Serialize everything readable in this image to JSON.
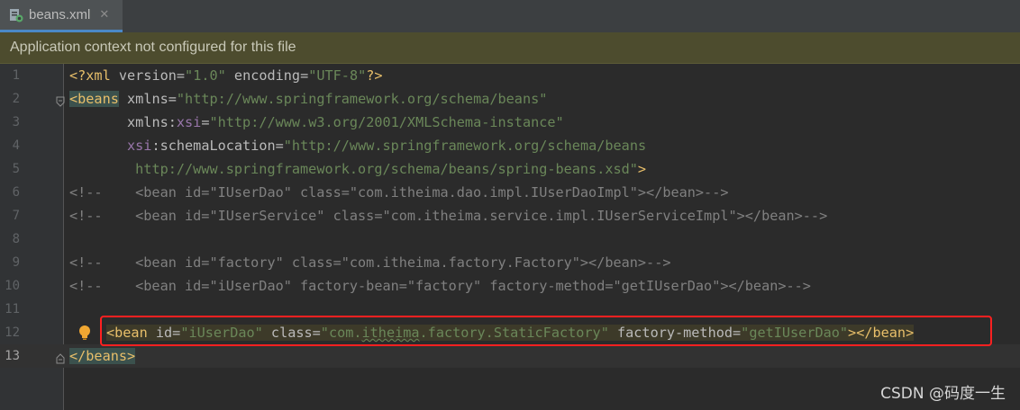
{
  "tab": {
    "filename": "beans.xml",
    "close": "✕",
    "icon": "xml-file-icon"
  },
  "banner": {
    "text": "Application context not configured for this file"
  },
  "lines": [
    {
      "n": "1"
    },
    {
      "n": "2"
    },
    {
      "n": "3"
    },
    {
      "n": "4"
    },
    {
      "n": "5"
    },
    {
      "n": "6"
    },
    {
      "n": "7"
    },
    {
      "n": "8"
    },
    {
      "n": "9"
    },
    {
      "n": "10"
    },
    {
      "n": "11"
    },
    {
      "n": "12"
    },
    {
      "n": "13"
    }
  ],
  "code": {
    "l1": {
      "open": "<?xml ",
      "a1": "version",
      "eq1": "=",
      "v1": "\"1.0\"",
      "sp": " ",
      "a2": "encoding",
      "eq2": "=",
      "v2": "\"UTF-8\"",
      "close": "?>"
    },
    "l2": {
      "tag": "<beans",
      "a1": "xmlns",
      "eq1": "=",
      "v1": "\"http://www.springframework.org/schema/beans\""
    },
    "l3": {
      "a1": "xmlns",
      "colon": ":",
      "ns": "xsi",
      "eq1": "=",
      "v1": "\"http://www.w3.org/2001/XMLSchema-instance\""
    },
    "l4": {
      "ns": "xsi",
      "colon": ":",
      "a1": "schemaLocation",
      "eq1": "=",
      "v1": "\"http://www.springframework.org/schema/beans"
    },
    "l5": {
      "v1": "http://www.springframework.org/schema/beans/spring-beans.xsd\"",
      "close": ">"
    },
    "l6": "<!--    <bean id=\"IUserDao\" class=\"com.itheima.dao.impl.IUserDaoImpl\"></bean>-->",
    "l7": "<!--    <bean id=\"IUserService\" class=\"com.itheima.service.impl.IUserServiceImpl\"></bean>-->",
    "l9": "<!--    <bean id=\"factory\" class=\"com.itheima.factory.Factory\"></bean>-->",
    "l10": "<!--    <bean id=\"iUserDao\" factory-bean=\"factory\" factory-method=\"getIUserDao\"></bean>-->",
    "l12": {
      "open": "<bean",
      "a1": "id",
      "eq1": "=",
      "v1": "\"iUserDao\"",
      "a2": "class",
      "eq2": "=",
      "v2a": "\"com.",
      "v2b": "itheima",
      "v2c": ".factory.StaticFactory\"",
      "a3": "factory-method",
      "eq3": "=",
      "v3": "\"getIUserDao\"",
      "gt": ">",
      "close": "</bean>"
    },
    "l13": {
      "close": "</beans>"
    }
  },
  "watermark": "CSDN @码度一生"
}
